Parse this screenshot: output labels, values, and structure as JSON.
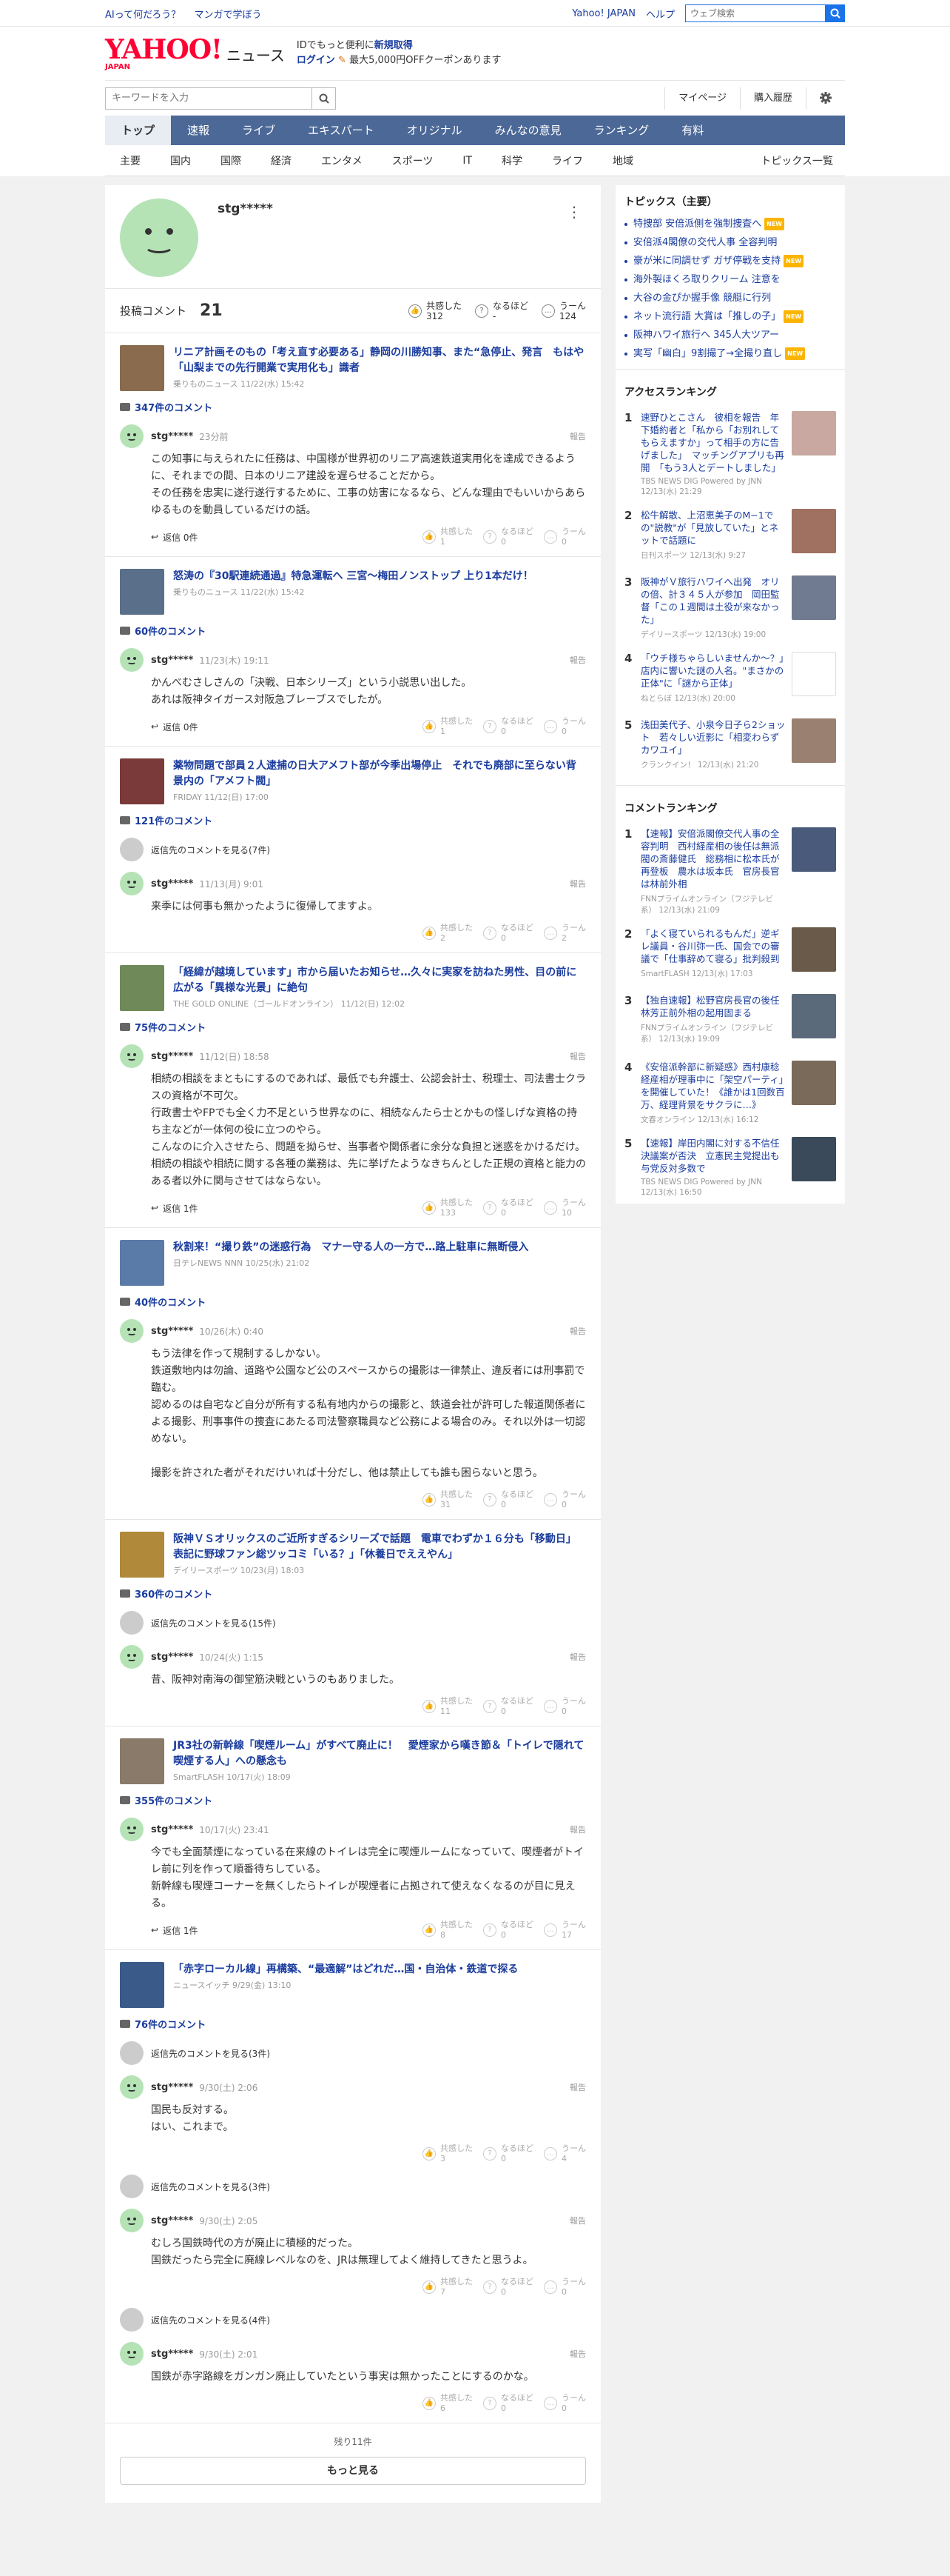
{
  "topbar": {
    "links": [
      "AIって何だろう？",
      "マンガで学ぼう"
    ],
    "right_links": [
      "Yahoo! JAPAN",
      "ヘルプ"
    ],
    "search_placeholder": "ウェブ検索"
  },
  "header": {
    "logo": "YAHOO!",
    "logo_sub": "JAPAN",
    "service": "ニュース",
    "promo_line1": "IDでもっと便利に",
    "promo_line1_hl": "新規取得",
    "promo_login": "ログイン",
    "promo_line2": "最大5,000円OFFクーポンあります"
  },
  "search": {
    "placeholder": "キーワードを入力",
    "mypage": "マイページ",
    "history": "購入履歴"
  },
  "nav": {
    "items": [
      "トップ",
      "速報",
      "ライブ",
      "エキスパート",
      "オリジナル",
      "みんなの意見",
      "ランキング",
      "有料"
    ],
    "active": 0
  },
  "subnav": {
    "items": [
      "主要",
      "国内",
      "国際",
      "経済",
      "エンタメ",
      "スポーツ",
      "IT",
      "科学",
      "ライフ",
      "地域"
    ],
    "all": "トピックス一覧"
  },
  "profile": {
    "username": "stg*****",
    "comment_label": "投稿コメント",
    "comment_count": "21",
    "reactions": [
      {
        "label": "共感した",
        "count": "312",
        "icon": "thumb"
      },
      {
        "label": "なるほど",
        "count": "-",
        "icon": "question"
      },
      {
        "label": "うーん",
        "count": "124",
        "icon": "hmm"
      }
    ]
  },
  "labels": {
    "report": "報告",
    "reply": "返信",
    "agree": "共感した",
    "hmm_naruhodo": "なるほど",
    "hmm": "うーん"
  },
  "articles": [
    {
      "title": "リニア計画そのもの「考え直す必要ある」静岡の川勝知事、また“急停止、発言　もはや「山梨までの先行開業で実用化も」識者",
      "meta": "乗りものニュース 11/22(水) 15:42",
      "thumb_color": "#8a6b4e",
      "comments_total": "347件のコメント",
      "items": [
        {
          "user": "stg*****",
          "date": "23分前",
          "text": "この知事に与えられたに任務は、中国様が世界初のリニア高速鉄道実用化を達成できるように、それまでの間、日本のリニア建設を遅らせることだから。\nその任務を忠実に遂行遂行するために、工事の妨害になるなら、どんな理由でもいいからあらゆるものを動員しているだけの話。",
          "reply": "返信 0件",
          "r1": "1",
          "r2": "0",
          "r3": "0"
        }
      ]
    },
    {
      "title": "怒涛の『30駅連続通過』特急運転へ 三宮～梅田ノンストップ 上り1本だけ！",
      "meta": "乗りものニュース 11/22(水) 15:42",
      "thumb_color": "#5a6f8a",
      "comments_total": "60件のコメント",
      "items": [
        {
          "user": "stg*****",
          "date": "11/23(木) 19:11",
          "text": "かんべむさしさんの「決戦、日本シリーズ」という小説思い出した。\nあれは阪神タイガース対阪急ブレーブスでしたが。",
          "reply": "返信 0件",
          "r1": "1",
          "r2": "0",
          "r3": "0"
        }
      ]
    },
    {
      "title": "薬物問題で部員２人逮捕の日大アメフト部が今季出場停止　それでも廃部に至らない背景内の「アメフト閥」",
      "meta": "FRIDAY 11/12(日) 17:00",
      "thumb_color": "#7a3a3a",
      "comments_total": "121件のコメント",
      "reply_more": "返信先のコメントを見る(7件)",
      "items": [
        {
          "user": "stg*****",
          "date": "11/13(月) 9:01",
          "text": "来季には何事も無かったように復帰してますよ。",
          "reply": "",
          "r1": "2",
          "r2": "0",
          "r3": "2"
        }
      ]
    },
    {
      "title": "「経緯が越境しています」市から届いたお知らせ…久々に実家を訪ねた男性、目の前に広がる「異様な光景」に絶句",
      "meta": "THE GOLD ONLINE（ゴールドオンライン） 11/12(日) 12:02",
      "thumb_color": "#6f8a58",
      "comments_total": "75件のコメント",
      "items": [
        {
          "user": "stg*****",
          "date": "11/12(日) 18:58",
          "text": "相続の相談をまともにするのであれば、最低でも弁護士、公認会計士、税理士、司法書士クラスの資格が不可欠。\n行政書士やFPでも全く力不足という世界なのに、相続なんたら士とかもの怪しげな資格の持ち主などが一体何の役に立つのやら。\nこんなのに介入させたら、問題を拗らせ、当事者や関係者に余分な負担と迷惑をかけるだけ。\n相続の相談や相続に関する各種の業務は、先に挙げたようなきちんとした正規の資格と能力のある者以外に関与させてはならない。",
          "reply": "返信 1件",
          "r1": "133",
          "r2": "0",
          "r3": "10"
        }
      ]
    },
    {
      "title": "秋割来！“撮り鉄”の迷惑行為　マナー守る人の一方で…路上駐車に無断侵入",
      "meta": "日テレNEWS NNN 10/25(水) 21:02",
      "thumb_color": "#5a7aa8",
      "comments_total": "40件のコメント",
      "items": [
        {
          "user": "stg*****",
          "date": "10/26(木) 0:40",
          "text": "もう法律を作って規制するしかない。\n鉄道敷地内は勿論、道路や公園など公のスペースからの撮影は一律禁止、違反者には刑事罰で臨む。\n認めるのは自宅など自分が所有する私有地内からの撮影と、鉄道会社が許可した報道関係者による撮影、刑事事件の捜査にあたる司法警察職員など公務による場合のみ。それ以外は一切認めない。\n\n撮影を許された者がそれだけいれば十分だし、他は禁止しても誰も困らないと思う。",
          "reply": "",
          "r1": "31",
          "r2": "0",
          "r3": "0"
        }
      ]
    },
    {
      "title": "阪神ＶＳオリックスのご近所すぎるシリーズで話題　電車でわずか１６分も「移動日」表記に野球ファン総ツッコミ「いる？」「休養日でええやん」",
      "meta": "デイリースポーツ 10/23(月) 18:03",
      "thumb_color": "#b08a3a",
      "comments_total": "360件のコメント",
      "reply_more": "返信先のコメントを見る(15件)",
      "items": [
        {
          "user": "stg*****",
          "date": "10/24(火) 1:15",
          "text": "昔、阪神対南海の御堂筋決戦というのもありました。",
          "reply": "",
          "r1": "11",
          "r2": "0",
          "r3": "0"
        }
      ]
    },
    {
      "title": "JR3社の新幹線「喫煙ルーム」がすべて廃止に！　愛煙家から嘆き節＆「トイレで隠れて喫煙する人」への懸念も",
      "meta": "SmartFLASH 10/17(火) 18:09",
      "thumb_color": "#8a7a6a",
      "comments_total": "355件のコメント",
      "items": [
        {
          "user": "stg*****",
          "date": "10/17(火) 23:41",
          "text": "今でも全面禁煙になっている在来線のトイレは完全に喫煙ルームになっていて、喫煙者がトイレ前に列を作って順番待ちしている。\n新幹線も喫煙コーナーを無くしたらトイレが喫煙者に占拠されて使えなくなるのが目に見える。",
          "reply": "返信 1件",
          "r1": "8",
          "r2": "0",
          "r3": "17"
        }
      ]
    },
    {
      "title": "「赤字ローカル線」再構築、“最適解”はどれだ…国・自治体・鉄道で探る",
      "meta": "ニュースイッチ 9/29(金) 13:10",
      "thumb_color": "#3a5a8a",
      "comments_total": "76件のコメント",
      "items": [
        {
          "reply_more": "返信先のコメントを見る(3件)",
          "user": "stg*****",
          "date": "9/30(土) 2:06",
          "text": "国民も反対する。\nはい、これまで。",
          "reply": "",
          "r1": "3",
          "r2": "0",
          "r3": "4"
        },
        {
          "reply_more": "返信先のコメントを見る(3件)",
          "user": "stg*****",
          "date": "9/30(土) 2:05",
          "text": "むしろ国鉄時代の方が廃止に積極的だった。\n国鉄だったら完全に廃線レベルなのを、JRは無理してよく維持してきたと思うよ。",
          "reply": "",
          "r1": "7",
          "r2": "0",
          "r3": "0"
        },
        {
          "reply_more": "返信先のコメントを見る(4件)",
          "user": "stg*****",
          "date": "9/30(土) 2:01",
          "text": "国鉄が赤字路線をガンガン廃止していたという事実は無かったことにするのかな。",
          "reply": "",
          "r1": "6",
          "r2": "0",
          "r3": "0"
        }
      ]
    }
  ],
  "more": {
    "rest": "残り11件",
    "button": "もっと見る"
  },
  "sidebar": {
    "topics_title": "トピックス（主要）",
    "topics": [
      {
        "t": "特捜部 安倍派側を強制捜査へ",
        "new": true
      },
      {
        "t": "安倍派4閣僚の交代人事 全容判明",
        "new": false
      },
      {
        "t": "豪が米に同調せず ガザ停戦を支持",
        "new": true
      },
      {
        "t": "海外製ほくろ取りクリーム 注意を",
        "new": false
      },
      {
        "t": "大谷の金ぴか握手像 競艇に行列",
        "new": false
      },
      {
        "t": "ネット流行語 大賞は「推しの子」",
        "new": true
      },
      {
        "t": "阪神ハワイ旅行へ 345人大ツアー",
        "new": false
      },
      {
        "t": "実写「幽白」9割撮了→全撮り直し",
        "new": true
      }
    ],
    "new_label": "NEW",
    "access_title": "アクセスランキング",
    "access": [
      {
        "n": "1",
        "t": "速野ひとこさん　彼相を報告　年下婚約者と「私から「お別れしてもらえますか」って相手の方に告げました」　マッチングアプリも再開　「もう3人とデートしました」",
        "s": "TBS NEWS DIG Powered by JNN 12/13(水) 21:29",
        "c": "#c8a8a0"
      },
      {
        "n": "2",
        "t": "松牛解散、上沼恵美子のM−1での\"説教\"が「見放していた」とネットで話題に",
        "s": "日刊スポーツ 12/13(水) 9:27",
        "c": "#a07060"
      },
      {
        "n": "3",
        "t": "阪神がＶ旅行ハワイへ出発　オリの倍、計３４５人が参加　岡田監督「この１週間は土役が来なかった」",
        "s": "デイリースポーツ 12/13(水) 19:00",
        "c": "#707a90"
      },
      {
        "n": "4",
        "t": "「ウチ様ちゃらしいませんか〜？」　店内に響いた謎の人名。\"まさかの正体\"に「謎から正体」",
        "s": "ねとらぼ 12/13(水) 20:00",
        "c": "#ffffff"
      },
      {
        "n": "5",
        "t": "浅田美代子、小泉今日子ら2ショット　若々しい近影に「相変わらずカワユイ」",
        "s": "クランクイン！ 12/13(水) 21:20",
        "c": "#9a8070"
      }
    ],
    "comment_title": "コメントランキング",
    "comments": [
      {
        "n": "1",
        "t": "【速報】安倍派閣僚交代人事の全容判明　西村経産相の後任は無派閥の斎藤健氏　総務相に松本氏が再登板　農水は坂本氏　官房長官は林前外相",
        "s": "FNNプライムオンライン（フジテレビ系） 12/13(水) 21:09",
        "c": "#4a5a7a"
      },
      {
        "n": "2",
        "t": "「よく寝ていられるもんだ」逆ギレ議員・谷川弥一氏、国会での審議で「仕事辞めて寝る」批判殺到",
        "s": "SmartFLASH 12/13(水) 17:03",
        "c": "#6a5a4a"
      },
      {
        "n": "3",
        "t": "【独自速報】松野官房長官の後任林芳正前外相の起用固まる",
        "s": "FNNプライムオンライン（フジテレビ系） 12/13(水) 19:09",
        "c": "#5a6a7a"
      },
      {
        "n": "4",
        "t": "《安倍派幹部に新疑惑》西村康稔経産相が理事中に「架空パーティ」を開催していた！《誰かは1回数百万、経理背景をサクラに…》",
        "s": "文春オンライン 12/13(水) 16:12",
        "c": "#7a6a5a"
      },
      {
        "n": "5",
        "t": "【速報】岸田内閣に対する不信任決議案が否決　立憲民主党提出も与党反対多数で",
        "s": "TBS NEWS DIG Powered by JNN 12/13(水) 16:50",
        "c": "#3a4a5a"
      }
    ]
  }
}
